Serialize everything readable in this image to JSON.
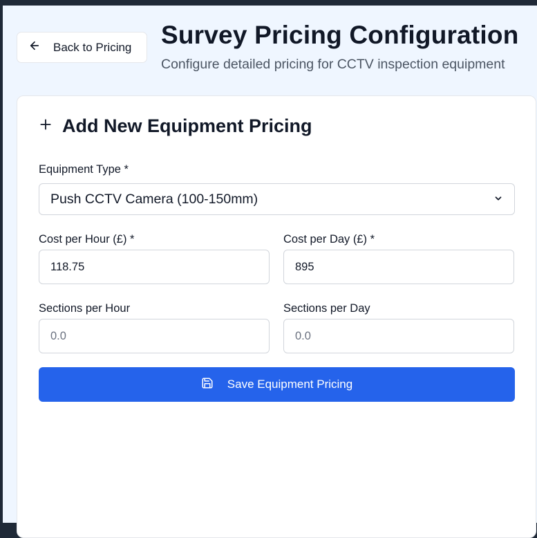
{
  "header": {
    "back_label": "Back to Pricing",
    "title": "Survey Pricing Configuration",
    "subtitle": "Configure detailed pricing for CCTV inspection equipment"
  },
  "form": {
    "heading": "Add New Equipment Pricing",
    "equipment_type": {
      "label": "Equipment Type *",
      "selected": "Push CCTV Camera (100-150mm)"
    },
    "cost_per_hour": {
      "label": "Cost per Hour (£) *",
      "value": "118.75"
    },
    "cost_per_day": {
      "label": "Cost per Day (£) *",
      "value": "895"
    },
    "sections_per_hour": {
      "label": "Sections per Hour",
      "placeholder": "0.0"
    },
    "sections_per_day": {
      "label": "Sections per Day",
      "placeholder": "0.0"
    },
    "save_label": "Save Equipment Pricing"
  },
  "icons": {
    "back": "arrow-left-icon",
    "add": "plus-icon",
    "dropdown": "chevron-down-icon",
    "save": "floppy-disk-icon"
  },
  "colors": {
    "accent": "#2563eb",
    "page_background": "#eff6ff",
    "text_primary": "#111827",
    "text_secondary": "#4b5563"
  }
}
